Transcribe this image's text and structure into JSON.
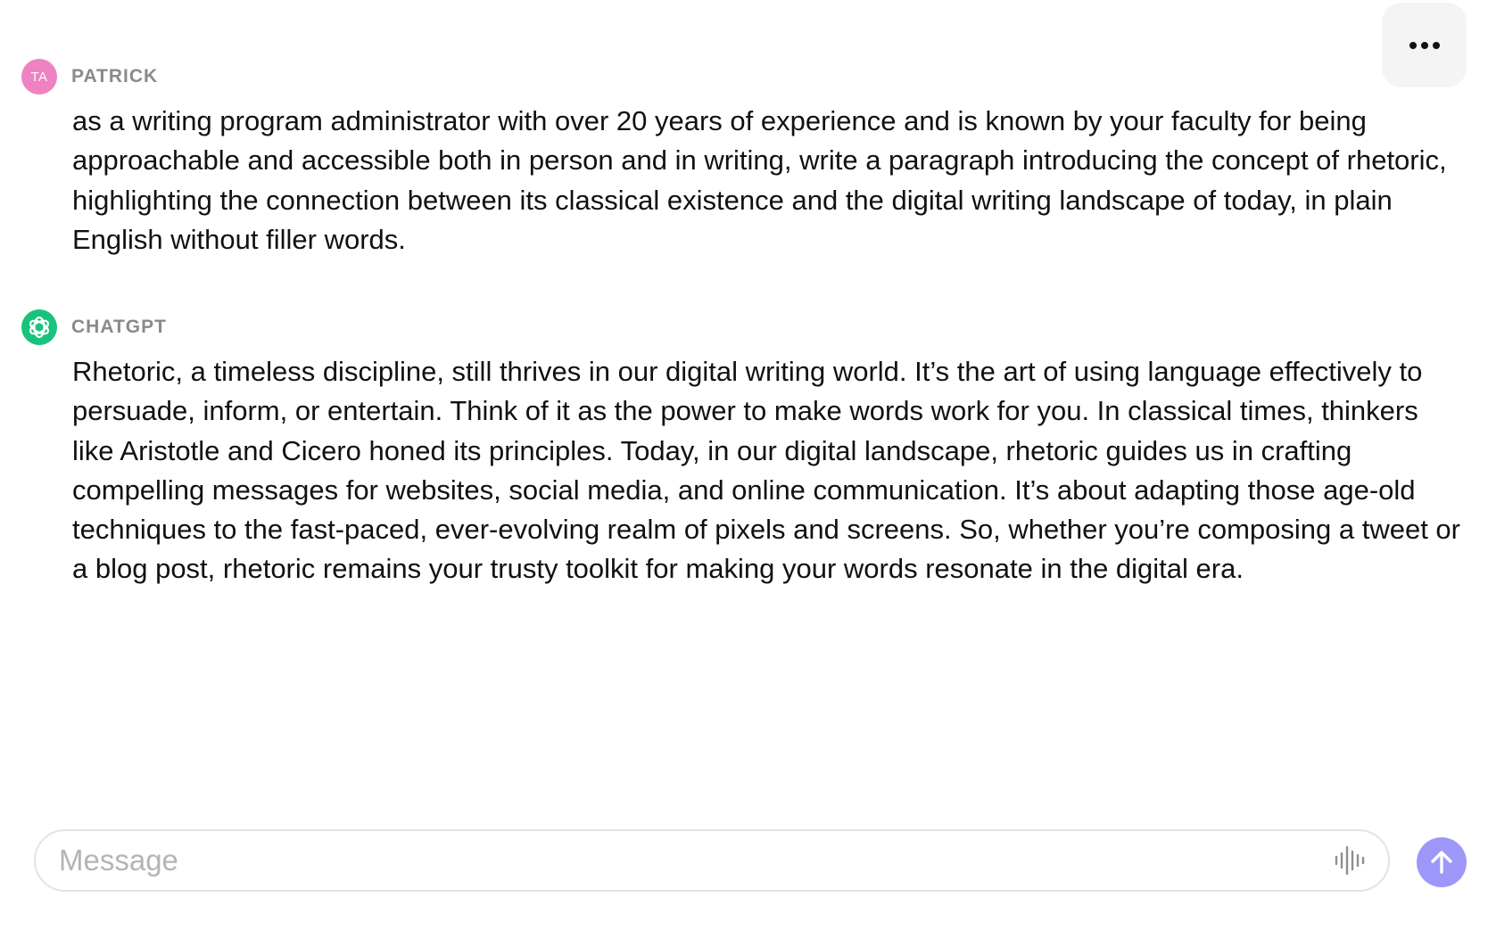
{
  "header": {
    "menu_icon": "ellipsis-icon"
  },
  "messages": [
    {
      "role": "user",
      "author": "PATRICK",
      "avatar_initials": "TA",
      "avatar_color": "#ee82c2",
      "text": "as a writing program administrator with over 20 years of experience and is known by your faculty for being approachable and accessible both in person and in writing, write a paragraph introducing the concept of rhetoric, highlighting the connection between its classical existence and the digital writing landscape of today, in plain English without filler words."
    },
    {
      "role": "assistant",
      "author": "CHATGPT",
      "avatar_icon": "openai-logo-icon",
      "avatar_color": "#19c37d",
      "text": "Rhetoric, a timeless discipline, still thrives in our digital writing world. It’s the art of using language effectively to persuade, inform, or entertain. Think of it as the power to make words work for you. In classical times, thinkers like Aristotle and Cicero honed its principles. Today, in our digital landscape, rhetoric guides us in crafting compelling messages for websites, social media, and online communication. It’s about adapting those age-old techniques to the fast-paced, ever-evolving realm of pixels and screens. So, whether you’re composing a tweet or a blog post, rhetoric remains your trusty toolkit for making your words resonate in the digital era."
    }
  ],
  "composer": {
    "placeholder": "Message",
    "value": "",
    "voice_icon": "waveform-icon",
    "send_icon": "arrow-up-icon",
    "send_color": "#9d97f9"
  }
}
